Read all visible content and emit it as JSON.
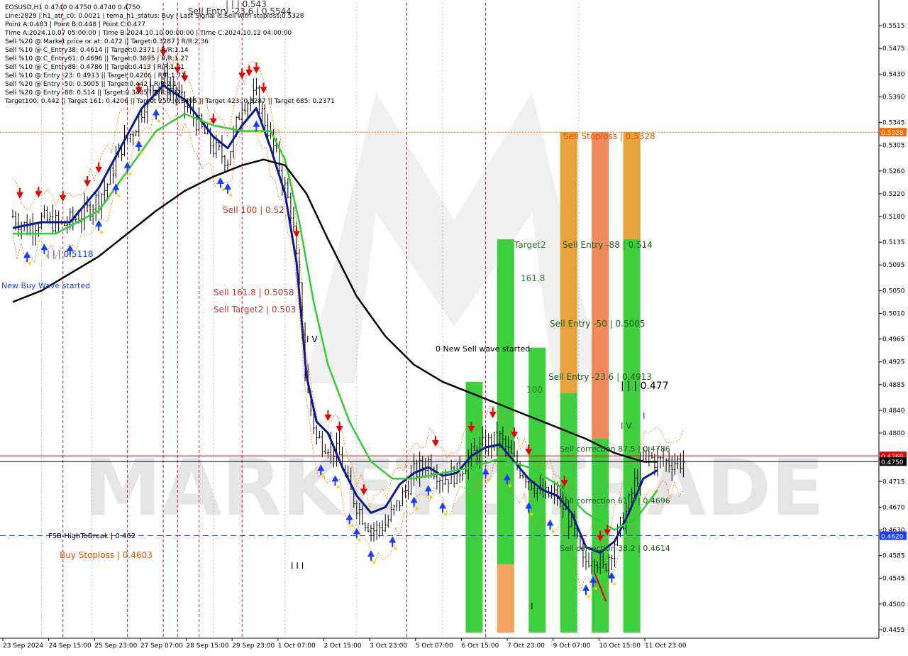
{
  "header": {
    "lines": [
      "EOSUSD,H1  0.4740 0.4750 0.4740 0.4750",
      "Line:2829 | h1_atr_c0: 0.0021 | tema_h1_status: Buy | Last Signal is:Sell with stoploss:0.5328",
      "Point A:0.483 | Point B:0.448 | Point C:0.477",
      "Time A:2024.10.07 05:00:00 | Time B:2024.10.10 00:00:00 | Time C:2024.10.12 04:00:00",
      "Sell %20 @ Market price or at: 0.472 || Target:0.3287 | R/R:2.36",
      "Sell %10 @ C_Entry38: 0.4614 || Target:0.2371 | R/R:1.14",
      "Sell %10 @ C_Entry61: 0.4696 || Target:0.3895 | R/R:1.27",
      "Sell %10 @ C_Entry88: 0.4786 || Target:0.413 | R/R:1.21",
      "Sell %10 @ Entry -23: 0.4913 || Target:0.4206 | R/R:1.71",
      "Sell %20 @ Entry -50: 0.5005 || Target:0.442 | R/R:2.1",
      "Sell %20 @ Entry -88: 0.514 || Target:0.3485 | R/R:1.22",
      "Target100: 0.442 || Target 161: 0.4206 || Target 250: 0.3895 || Target 423: 0.3287 || Target 685: 0.2371"
    ]
  },
  "watermark": "MARKETZ TRADE",
  "price_axis": {
    "ticks": [
      "0.5515",
      "0.5475",
      "0.5430",
      "0.5390",
      "0.5345",
      "0.5305",
      "0.5260",
      "0.5220",
      "0.5180",
      "0.5135",
      "0.5095",
      "0.5050",
      "0.5010",
      "0.4965",
      "0.4925",
      "0.4885",
      "0.4840",
      "0.4800",
      "0.4755",
      "0.4715",
      "0.4670",
      "0.4630",
      "0.4585",
      "0.4545",
      "0.4500",
      "0.4455"
    ],
    "tick_values": [
      0.5515,
      0.5475,
      0.543,
      0.539,
      0.5345,
      0.5305,
      0.526,
      0.522,
      0.518,
      0.5135,
      0.5095,
      0.505,
      0.501,
      0.4965,
      0.4925,
      0.4885,
      0.484,
      0.48,
      0.4755,
      0.4715,
      0.467,
      0.463,
      0.4585,
      0.4545,
      0.45,
      0.4455
    ],
    "badges": [
      {
        "label": "0.5328",
        "value": 0.5328,
        "bg": "#ff6a00",
        "fg": "#ffffff"
      },
      {
        "label": "0.4760",
        "value": 0.476,
        "bg": "#e60000",
        "fg": "#ffffff"
      },
      {
        "label": "0.4750",
        "value": 0.475,
        "bg": "#000000",
        "fg": "#ffffff"
      },
      {
        "label": "0.4620",
        "value": 0.462,
        "bg": "#1a3cff",
        "fg": "#ffffff"
      }
    ]
  },
  "time_axis": {
    "labels": [
      "23 Sep 2024",
      "24 Sep 15:00",
      "25 Sep 23:00",
      "27 Sep 07:00",
      "28 Sep 15:00",
      "29 Sep 23:00",
      "1 Oct 07:00",
      "2 Oct 15:00",
      "3 Oct 23:00",
      "5 Oct 07:00",
      "6 Oct 15:00",
      "7 Oct 23:00",
      "9 Oct 07:00",
      "10 Oct 15:00",
      "11 Oct 23:00"
    ],
    "label_bars": [
      0,
      32,
      64,
      96,
      128,
      160,
      192,
      224,
      256,
      288,
      320,
      352,
      384,
      416,
      448
    ]
  },
  "annotations": [
    {
      "text": "Sell Entry -23.6 | 0.5544",
      "color": "#333333"
    },
    {
      "text": "| | | 0.543",
      "color": "#333333"
    },
    {
      "text": "Sell 100 | 0.52",
      "color": "#c0392b"
    },
    {
      "text": "| | | 0.5118",
      "color": "#1a3cff"
    },
    {
      "text": "New Buy Wave started",
      "color": "#1a3cff"
    },
    {
      "text": "Sell 161.8 | 0.5058",
      "color": "#c0392b"
    },
    {
      "text": "Sell Target2 | 0.503",
      "color": "#c0392b"
    },
    {
      "text": "I V",
      "color": "#000000"
    },
    {
      "text": "0 New Sell wave started",
      "color": "#000000"
    },
    {
      "text": "Target2",
      "color": "#2e7d32"
    },
    {
      "text": "161.8",
      "color": "#2e7d32"
    },
    {
      "text": "100",
      "color": "#2e7d32"
    },
    {
      "text": "Sell Stoploss | 0.5328",
      "color": "#e65100"
    },
    {
      "text": "Sell Entry -88 | 0.514",
      "color": "#1b5e20"
    },
    {
      "text": "Sell Entry -50 | 0.5005",
      "color": "#1b5e20"
    },
    {
      "text": "Sell Entry -23.6 | 0.4913",
      "color": "#1b5e20"
    },
    {
      "text": "| | | 0.477",
      "color": "#000000"
    },
    {
      "text": "I V",
      "color": "#1b5e20"
    },
    {
      "text": "I",
      "color": "#1a3cff"
    },
    {
      "text": "Sell correction 87.5 | 0.4786",
      "color": "#1b5e20"
    },
    {
      "text": "Sell correction 61.8 | 0.4696",
      "color": "#1b5e20"
    },
    {
      "text": "Sell correction 38.2 | 0.4614",
      "color": "#1b5e20"
    },
    {
      "text": "FSB-HighToBreak | 0.462",
      "color": "#000000"
    },
    {
      "text": "Buy Stoploss | 0.4603",
      "color": "#e65100"
    },
    {
      "text": "I I I",
      "color": "#000000"
    },
    {
      "text": "I",
      "color": "#000000"
    }
  ],
  "chart_data": {
    "type": "candlestick",
    "symbol": "EOSUSD",
    "timeframe": "H1",
    "ylim": [
      0.444,
      0.5555
    ],
    "bars": 470,
    "last_price": 0.475,
    "key_levels": [
      {
        "name": "Sell Stoploss",
        "value": 0.5328,
        "color": "#ff6a00",
        "style": "dotted"
      },
      {
        "name": "Ask",
        "value": 0.476,
        "color": "#e60000",
        "style": "solid"
      },
      {
        "name": "Bid",
        "value": 0.475,
        "color": "#000000",
        "style": "solid"
      },
      {
        "name": "FSB-HighToBreak",
        "value": 0.462,
        "color": "#1a3cff",
        "style": "dashed"
      }
    ],
    "price_path": [
      {
        "bar": 0,
        "price": 0.518
      },
      {
        "bar": 10,
        "price": 0.516
      },
      {
        "bar": 20,
        "price": 0.5175
      },
      {
        "bar": 35,
        "price": 0.5165
      },
      {
        "bar": 50,
        "price": 0.5185
      },
      {
        "bar": 65,
        "price": 0.523
      },
      {
        "bar": 75,
        "price": 0.53
      },
      {
        "bar": 85,
        "price": 0.5335
      },
      {
        "bar": 95,
        "price": 0.54
      },
      {
        "bar": 105,
        "price": 0.542
      },
      {
        "bar": 115,
        "price": 0.539
      },
      {
        "bar": 125,
        "price": 0.536
      },
      {
        "bar": 140,
        "price": 0.53
      },
      {
        "bar": 150,
        "price": 0.528
      },
      {
        "bar": 160,
        "price": 0.538
      },
      {
        "bar": 170,
        "price": 0.539
      },
      {
        "bar": 180,
        "price": 0.532
      },
      {
        "bar": 190,
        "price": 0.523
      },
      {
        "bar": 195,
        "price": 0.518
      },
      {
        "bar": 200,
        "price": 0.505
      },
      {
        "bar": 205,
        "price": 0.488
      },
      {
        "bar": 212,
        "price": 0.479
      },
      {
        "bar": 220,
        "price": 0.478
      },
      {
        "bar": 228,
        "price": 0.476
      },
      {
        "bar": 235,
        "price": 0.47
      },
      {
        "bar": 245,
        "price": 0.465
      },
      {
        "bar": 252,
        "price": 0.463
      },
      {
        "bar": 260,
        "price": 0.464
      },
      {
        "bar": 270,
        "price": 0.468
      },
      {
        "bar": 280,
        "price": 0.473
      },
      {
        "bar": 290,
        "price": 0.475
      },
      {
        "bar": 300,
        "price": 0.472
      },
      {
        "bar": 310,
        "price": 0.473
      },
      {
        "bar": 320,
        "price": 0.476
      },
      {
        "bar": 330,
        "price": 0.478
      },
      {
        "bar": 340,
        "price": 0.479
      },
      {
        "bar": 350,
        "price": 0.475
      },
      {
        "bar": 360,
        "price": 0.472
      },
      {
        "bar": 370,
        "price": 0.469
      },
      {
        "bar": 380,
        "price": 0.469
      },
      {
        "bar": 390,
        "price": 0.464
      },
      {
        "bar": 398,
        "price": 0.457
      },
      {
        "bar": 405,
        "price": 0.459
      },
      {
        "bar": 412,
        "price": 0.456
      },
      {
        "bar": 420,
        "price": 0.461
      },
      {
        "bar": 428,
        "price": 0.466
      },
      {
        "bar": 435,
        "price": 0.472
      },
      {
        "bar": 442,
        "price": 0.476
      },
      {
        "bar": 450,
        "price": 0.475
      }
    ],
    "series": [
      {
        "name": "tema",
        "color": "#0d1a8c",
        "values": [
          {
            "bar": 0,
            "price": 0.516
          },
          {
            "bar": 20,
            "price": 0.517
          },
          {
            "bar": 40,
            "price": 0.517
          },
          {
            "bar": 60,
            "price": 0.523
          },
          {
            "bar": 75,
            "price": 0.53
          },
          {
            "bar": 90,
            "price": 0.537
          },
          {
            "bar": 105,
            "price": 0.541
          },
          {
            "bar": 120,
            "price": 0.5385
          },
          {
            "bar": 140,
            "price": 0.532
          },
          {
            "bar": 150,
            "price": 0.53
          },
          {
            "bar": 160,
            "price": 0.534
          },
          {
            "bar": 170,
            "price": 0.537
          },
          {
            "bar": 180,
            "price": 0.53
          },
          {
            "bar": 190,
            "price": 0.522
          },
          {
            "bar": 198,
            "price": 0.51
          },
          {
            "bar": 205,
            "price": 0.49
          },
          {
            "bar": 212,
            "price": 0.482
          },
          {
            "bar": 220,
            "price": 0.48
          },
          {
            "bar": 230,
            "price": 0.474
          },
          {
            "bar": 240,
            "price": 0.469
          },
          {
            "bar": 250,
            "price": 0.466
          },
          {
            "bar": 260,
            "price": 0.467
          },
          {
            "bar": 270,
            "price": 0.471
          },
          {
            "bar": 280,
            "price": 0.473
          },
          {
            "bar": 290,
            "price": 0.474
          },
          {
            "bar": 300,
            "price": 0.4725
          },
          {
            "bar": 310,
            "price": 0.473
          },
          {
            "bar": 320,
            "price": 0.476
          },
          {
            "bar": 330,
            "price": 0.4775
          },
          {
            "bar": 340,
            "price": 0.478
          },
          {
            "bar": 350,
            "price": 0.475
          },
          {
            "bar": 360,
            "price": 0.472
          },
          {
            "bar": 370,
            "price": 0.47
          },
          {
            "bar": 380,
            "price": 0.469
          },
          {
            "bar": 390,
            "price": 0.466
          },
          {
            "bar": 400,
            "price": 0.46
          },
          {
            "bar": 410,
            "price": 0.459
          },
          {
            "bar": 420,
            "price": 0.461
          },
          {
            "bar": 430,
            "price": 0.466
          },
          {
            "bar": 440,
            "price": 0.472
          },
          {
            "bar": 450,
            "price": 0.4735
          }
        ]
      },
      {
        "name": "ma_fast",
        "color": "#33cc33",
        "values": [
          {
            "bar": 0,
            "price": 0.515
          },
          {
            "bar": 30,
            "price": 0.515
          },
          {
            "bar": 60,
            "price": 0.519
          },
          {
            "bar": 80,
            "price": 0.526
          },
          {
            "bar": 100,
            "price": 0.533
          },
          {
            "bar": 120,
            "price": 0.536
          },
          {
            "bar": 140,
            "price": 0.534
          },
          {
            "bar": 160,
            "price": 0.533
          },
          {
            "bar": 180,
            "price": 0.533
          },
          {
            "bar": 190,
            "price": 0.528
          },
          {
            "bar": 200,
            "price": 0.517
          },
          {
            "bar": 210,
            "price": 0.503
          },
          {
            "bar": 220,
            "price": 0.492
          },
          {
            "bar": 235,
            "price": 0.482
          },
          {
            "bar": 250,
            "price": 0.475
          },
          {
            "bar": 265,
            "price": 0.472
          },
          {
            "bar": 280,
            "price": 0.472
          },
          {
            "bar": 300,
            "price": 0.473
          },
          {
            "bar": 320,
            "price": 0.474
          },
          {
            "bar": 340,
            "price": 0.4755
          },
          {
            "bar": 360,
            "price": 0.474
          },
          {
            "bar": 380,
            "price": 0.471
          },
          {
            "bar": 400,
            "price": 0.466
          },
          {
            "bar": 420,
            "price": 0.463
          },
          {
            "bar": 435,
            "price": 0.465
          },
          {
            "bar": 450,
            "price": 0.47
          }
        ]
      },
      {
        "name": "ma_slow",
        "color": "#000000",
        "values": [
          {
            "bar": 0,
            "price": 0.503
          },
          {
            "bar": 20,
            "price": 0.505
          },
          {
            "bar": 40,
            "price": 0.508
          },
          {
            "bar": 60,
            "price": 0.511
          },
          {
            "bar": 80,
            "price": 0.515
          },
          {
            "bar": 100,
            "price": 0.519
          },
          {
            "bar": 120,
            "price": 0.5225
          },
          {
            "bar": 140,
            "price": 0.525
          },
          {
            "bar": 160,
            "price": 0.527
          },
          {
            "bar": 175,
            "price": 0.528
          },
          {
            "bar": 190,
            "price": 0.527
          },
          {
            "bar": 205,
            "price": 0.522
          },
          {
            "bar": 220,
            "price": 0.514
          },
          {
            "bar": 240,
            "price": 0.504
          },
          {
            "bar": 260,
            "price": 0.497
          },
          {
            "bar": 280,
            "price": 0.492
          },
          {
            "bar": 300,
            "price": 0.489
          },
          {
            "bar": 320,
            "price": 0.487
          },
          {
            "bar": 340,
            "price": 0.485
          },
          {
            "bar": 360,
            "price": 0.483
          },
          {
            "bar": 380,
            "price": 0.481
          },
          {
            "bar": 400,
            "price": 0.479
          },
          {
            "bar": 420,
            "price": 0.4765
          },
          {
            "bar": 440,
            "price": 0.475
          },
          {
            "bar": 450,
            "price": 0.475
          }
        ]
      }
    ],
    "zone_bars": [
      {
        "bar": 322,
        "from": 0.445,
        "to": 0.489,
        "color": "#33cc33"
      },
      {
        "bar": 344,
        "from": 0.445,
        "to": 0.514,
        "color": "#33cc33",
        "top_color": "#f4a460",
        "top_from": 0.445,
        "top_to": 0.457
      },
      {
        "bar": 366,
        "from": 0.445,
        "to": 0.495,
        "color": "#33cc33"
      },
      {
        "bar": 388,
        "from": 0.445,
        "to": 0.5328,
        "color": "#33cc33",
        "top_color": "#e8a33c",
        "top_from": 0.487,
        "top_to": 0.5328
      },
      {
        "bar": 410,
        "from": 0.445,
        "to": 0.5328,
        "color": "#33cc33",
        "top_color": "#f08a5d",
        "top_from": 0.479,
        "top_to": 0.5328
      },
      {
        "bar": 432,
        "from": 0.445,
        "to": 0.5328,
        "color": "#33cc33",
        "top_color": "#e8a33c",
        "top_from": 0.514,
        "top_to": 0.5328
      }
    ],
    "vertical_markers": {
      "magenta": [
        35,
        80,
        105,
        115,
        130,
        160,
        275,
        330
      ],
      "blue": [
        20,
        55,
        140,
        190,
        240,
        300,
        395
      ]
    },
    "sell_arrows": [
      5,
      18,
      35,
      52,
      60,
      88,
      105,
      115,
      120,
      140,
      160,
      165,
      170,
      175,
      198,
      220,
      228,
      245,
      295,
      320,
      335,
      350,
      360,
      385,
      410,
      415
    ],
    "buy_arrows": [
      10,
      22,
      40,
      60,
      72,
      80,
      88,
      100,
      145,
      150,
      170,
      215,
      225,
      235,
      240,
      250,
      265,
      280,
      290,
      300,
      330,
      345,
      360,
      375,
      400,
      405,
      418
    ]
  }
}
